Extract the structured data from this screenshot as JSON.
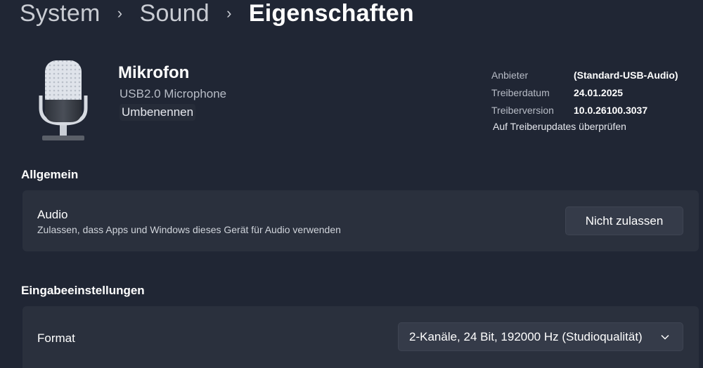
{
  "breadcrumb": {
    "items": [
      "System",
      "Sound",
      "Eigenschaften"
    ],
    "separator": "›"
  },
  "device": {
    "icon": "microphone-icon",
    "name": "Mikrofon",
    "model": "USB2.0 Microphone",
    "rename_label": "Umbenennen"
  },
  "driver": {
    "rows": [
      {
        "label": "Anbieter",
        "value": "(Standard-USB-Audio)"
      },
      {
        "label": "Treiberdatum",
        "value": "24.01.2025"
      },
      {
        "label": "Treiberversion",
        "value": "10.0.26100.3037"
      }
    ],
    "update_link": "Auf Treiberupdates überprüfen"
  },
  "general": {
    "section_title": "Allgemein",
    "audio": {
      "title": "Audio",
      "description": "Zulassen, dass Apps und Windows dieses Gerät für Audio verwenden",
      "button_label": "Nicht zulassen"
    }
  },
  "input_settings": {
    "section_title": "Eingabeeinstellungen",
    "format": {
      "label": "Format",
      "selected": "2-Kanäle, 24 Bit, 192000 Hz (Studioqualität)",
      "dropdown_icon": "chevron-down-icon"
    }
  },
  "colors": {
    "background": "#202634",
    "card": "#2a303d",
    "button": "#353b49"
  }
}
